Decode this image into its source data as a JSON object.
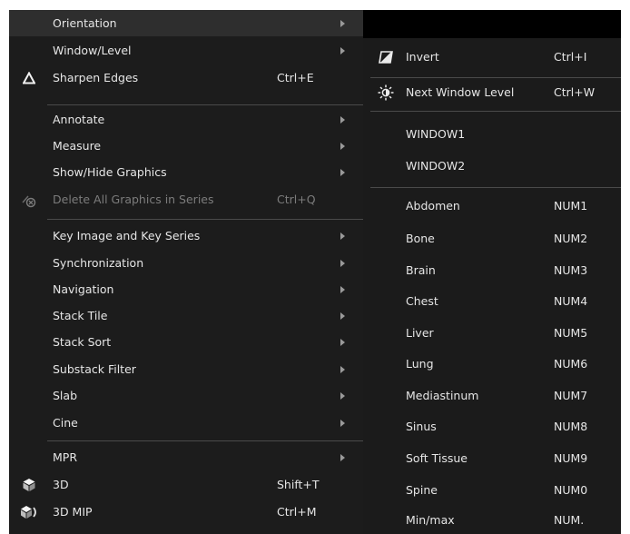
{
  "main_menu": {
    "items": [
      {
        "label": "Orientation",
        "has_submenu": true
      },
      {
        "label": "Window/Level",
        "has_submenu": true
      },
      {
        "label": "Sharpen Edges",
        "shortcut": "Ctrl+E",
        "icon": "delta-icon"
      },
      {
        "label": "Annotate",
        "has_submenu": true
      },
      {
        "label": "Measure",
        "has_submenu": true
      },
      {
        "label": "Show/Hide Graphics",
        "has_submenu": true
      },
      {
        "label": "Delete All Graphics in Series",
        "shortcut": "Ctrl+Q",
        "icon": "delete-graphics-icon",
        "disabled": true
      },
      {
        "label": "Key Image and Key Series",
        "has_submenu": true
      },
      {
        "label": "Synchronization",
        "has_submenu": true
      },
      {
        "label": "Navigation",
        "has_submenu": true
      },
      {
        "label": "Stack Tile",
        "has_submenu": true
      },
      {
        "label": "Stack Sort",
        "has_submenu": true
      },
      {
        "label": "Substack Filter",
        "has_submenu": true
      },
      {
        "label": "Slab",
        "has_submenu": true
      },
      {
        "label": "Cine",
        "has_submenu": true
      },
      {
        "label": "MPR",
        "has_submenu": true
      },
      {
        "label": "3D",
        "shortcut": "Shift+T",
        "icon": "cube-3d-icon"
      },
      {
        "label": "3D MIP",
        "shortcut": "Ctrl+M",
        "icon": "cube-mip-icon"
      }
    ]
  },
  "window_level_submenu": {
    "items": [
      {
        "label": "Invert",
        "shortcut": "Ctrl+I",
        "icon": "invert-icon"
      },
      {
        "label": "Next Window Level",
        "shortcut": "Ctrl+W",
        "icon": "brightness-icon"
      },
      {
        "label": "WINDOW1"
      },
      {
        "label": "WINDOW2"
      },
      {
        "label": "Abdomen",
        "shortcut": "NUM1"
      },
      {
        "label": "Bone",
        "shortcut": "NUM2"
      },
      {
        "label": "Brain",
        "shortcut": "NUM3"
      },
      {
        "label": "Chest",
        "shortcut": "NUM4"
      },
      {
        "label": "Liver",
        "shortcut": "NUM5"
      },
      {
        "label": "Lung",
        "shortcut": "NUM6"
      },
      {
        "label": "Mediastinum",
        "shortcut": "NUM7"
      },
      {
        "label": "Sinus",
        "shortcut": "NUM8"
      },
      {
        "label": "Soft Tissue",
        "shortcut": "NUM9"
      },
      {
        "label": "Spine",
        "shortcut": "NUM0"
      },
      {
        "label": "Min/max",
        "shortcut": "NUM."
      }
    ]
  },
  "colors": {
    "menu_background": "#1c1c1c",
    "highlight_background": "#2e2e2e",
    "text": "#e6e6e6",
    "disabled_text": "#7c7c7c",
    "separator": "#4a4a4a"
  }
}
